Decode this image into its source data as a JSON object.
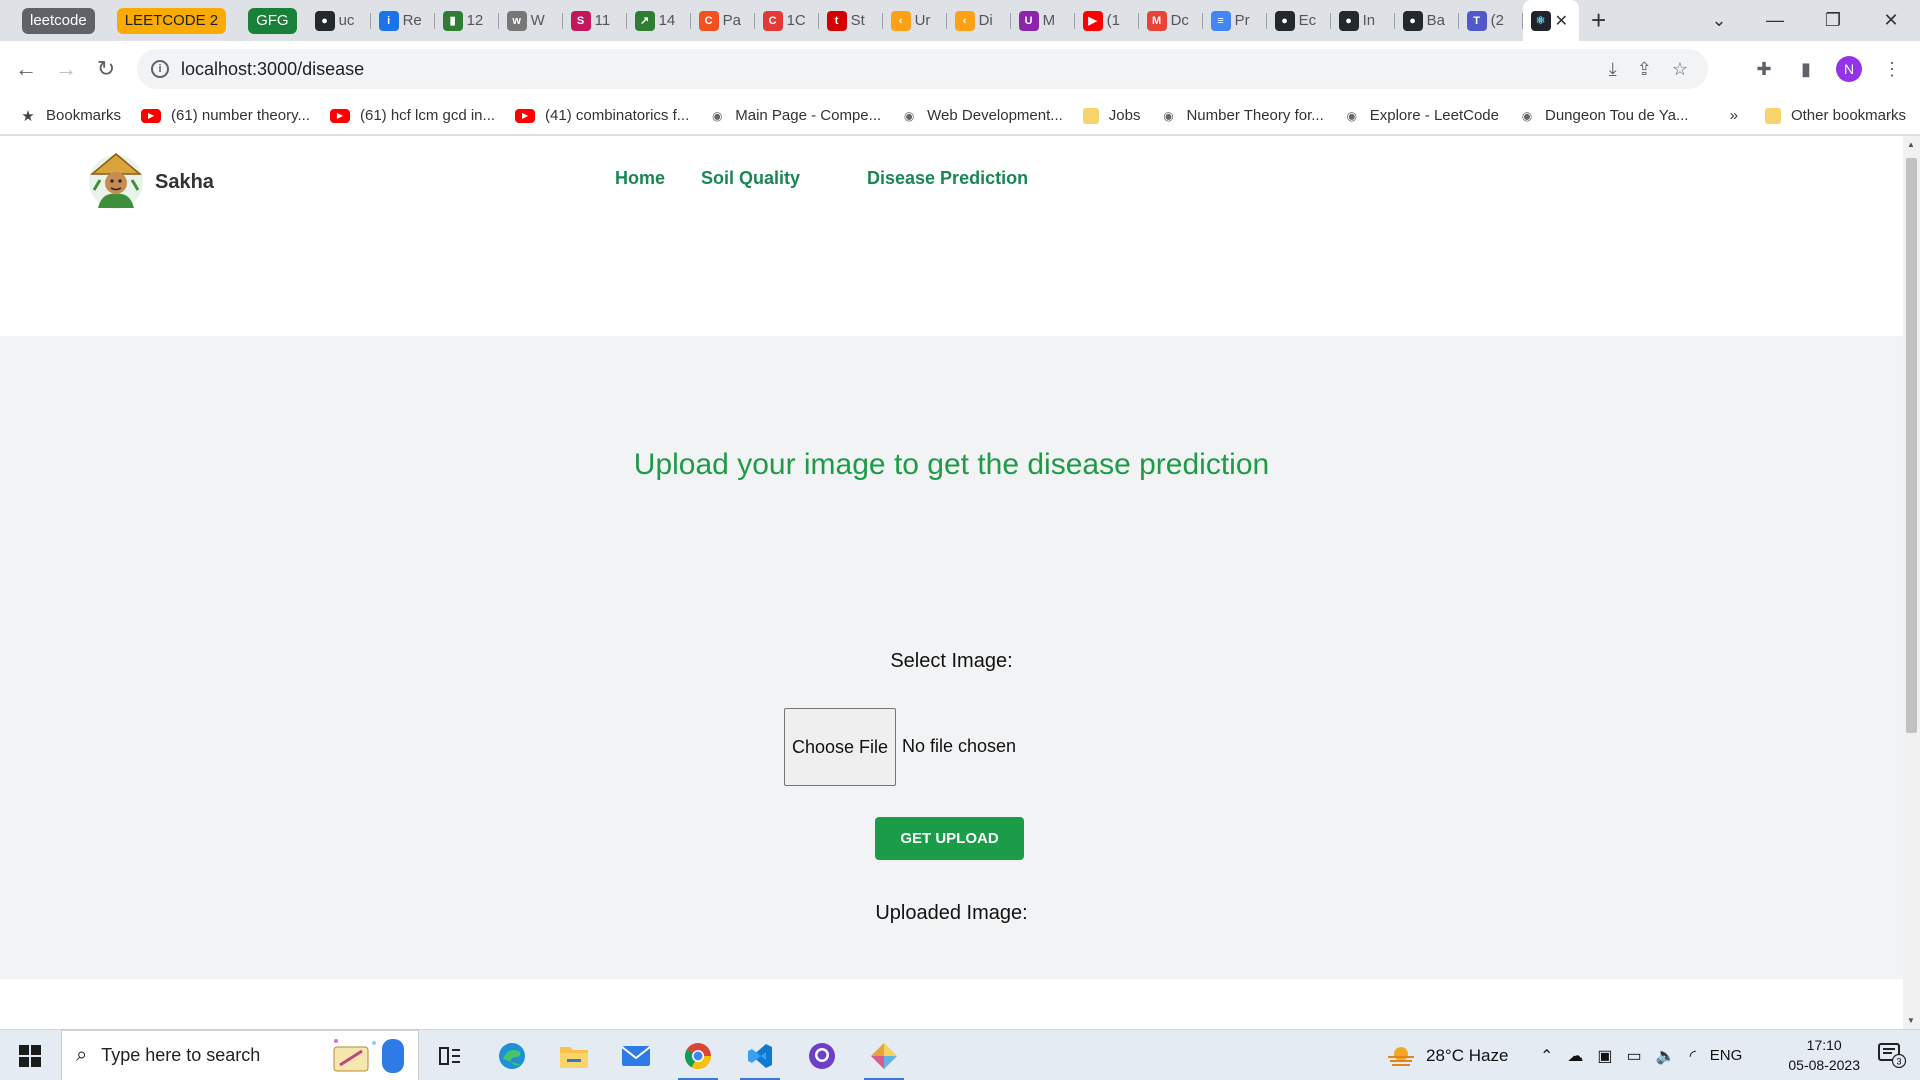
{
  "browser": {
    "tab_groups": [
      {
        "label": "leetcode",
        "bg": "#5f6368",
        "fg": "#ffffff"
      },
      {
        "label": "LEETCODE 2",
        "bg": "#f9ab00",
        "fg": "#202124"
      },
      {
        "label": "GFG",
        "bg": "#188038",
        "fg": "#ffffff"
      }
    ],
    "tabs": [
      {
        "text": "uc",
        "icon": "github-icon",
        "color": "#24292e",
        "glyph": "●"
      },
      {
        "text": "Re",
        "icon": "info-icon",
        "color": "#1a73e8",
        "glyph": "i"
      },
      {
        "text": "12",
        "icon": "bookmark-green-icon",
        "color": "#2e7d32",
        "glyph": "▮"
      },
      {
        "text": "W",
        "icon": "wiki-icon",
        "color": "#777777",
        "glyph": "w"
      },
      {
        "text": "11",
        "icon": "scaler-icon",
        "color": "#c2185b",
        "glyph": "S"
      },
      {
        "text": "14",
        "icon": "chart-icon",
        "color": "#2e7d32",
        "glyph": "↗"
      },
      {
        "text": "Pa",
        "icon": "codeforces-icon",
        "color": "#f4511e",
        "glyph": "C"
      },
      {
        "text": "1C",
        "icon": "codechef-icon",
        "color": "#e53935",
        "glyph": "C"
      },
      {
        "text": "St",
        "icon": "tuf-icon",
        "color": "#d50000",
        "glyph": "t"
      },
      {
        "text": "Ur",
        "icon": "leetcode-icon",
        "color": "#ffa116",
        "glyph": "‹"
      },
      {
        "text": "Di",
        "icon": "leetcode-icon",
        "color": "#ffa116",
        "glyph": "‹"
      },
      {
        "text": "M",
        "icon": "udemy-icon",
        "color": "#8e24aa",
        "glyph": "U"
      },
      {
        "text": "(1",
        "icon": "youtube-icon",
        "color": "#ff0000",
        "glyph": "▶"
      },
      {
        "text": "Dc",
        "icon": "gmail-icon",
        "color": "#ea4335",
        "glyph": "M"
      },
      {
        "text": "Pr",
        "icon": "docs-icon",
        "color": "#4285f4",
        "glyph": "≡"
      },
      {
        "text": "Ec",
        "icon": "github-icon",
        "color": "#24292e",
        "glyph": "●"
      },
      {
        "text": "In",
        "icon": "github-icon",
        "color": "#24292e",
        "glyph": "●"
      },
      {
        "text": "Ba",
        "icon": "github-icon",
        "color": "#24292e",
        "glyph": "●"
      },
      {
        "text": "(2",
        "icon": "teams-icon",
        "color": "#5059c9",
        "glyph": "T"
      }
    ],
    "active_tab": {
      "icon": "react-icon",
      "color": "#20232a",
      "glyph": "⚛"
    },
    "url": "localhost:3000/disease",
    "profile_initial": "N",
    "bookmarks": [
      {
        "label": "Bookmarks",
        "icon": "star-icon",
        "kind": "star"
      },
      {
        "label": "(61) number theory...",
        "icon": "youtube-icon",
        "kind": "yt"
      },
      {
        "label": "(61) hcf lcm gcd in...",
        "icon": "youtube-icon",
        "kind": "yt"
      },
      {
        "label": "(41) combinatorics f...",
        "icon": "youtube-icon",
        "kind": "yt"
      },
      {
        "label": "Main Page - Compe...",
        "icon": "cp-algorithms-icon",
        "kind": "plain"
      },
      {
        "label": "Web Development...",
        "icon": "web-dev-icon",
        "kind": "plain"
      },
      {
        "label": "Jobs",
        "icon": "folder-icon",
        "kind": "folder"
      },
      {
        "label": "Number Theory for...",
        "icon": "gfg-icon",
        "kind": "plain"
      },
      {
        "label": "Explore - LeetCode",
        "icon": "leetcode-icon",
        "kind": "plain"
      },
      {
        "label": "Dungeon Tou de Ya...",
        "icon": "globe-icon",
        "kind": "plain"
      }
    ],
    "bookmarks_overflow": "»",
    "other_bookmarks": "Other bookmarks"
  },
  "site": {
    "brand": "Sakha",
    "nav": [
      "Home",
      "Soil Quality",
      "Disease Prediction"
    ],
    "headline": "Upload your image to get the disease prediction",
    "select_label": "Select Image:",
    "file_button": "Choose File",
    "file_status": "No file chosen",
    "upload_button": "GET UPLOAD",
    "uploaded_label": "Uploaded Image:",
    "accent": "#1a9c48"
  },
  "taskbar": {
    "search_placeholder": "Type here to search",
    "weather": "28°C  Haze",
    "language": "ENG",
    "time": "17:10",
    "date": "05-08-2023",
    "notifications": "3"
  }
}
